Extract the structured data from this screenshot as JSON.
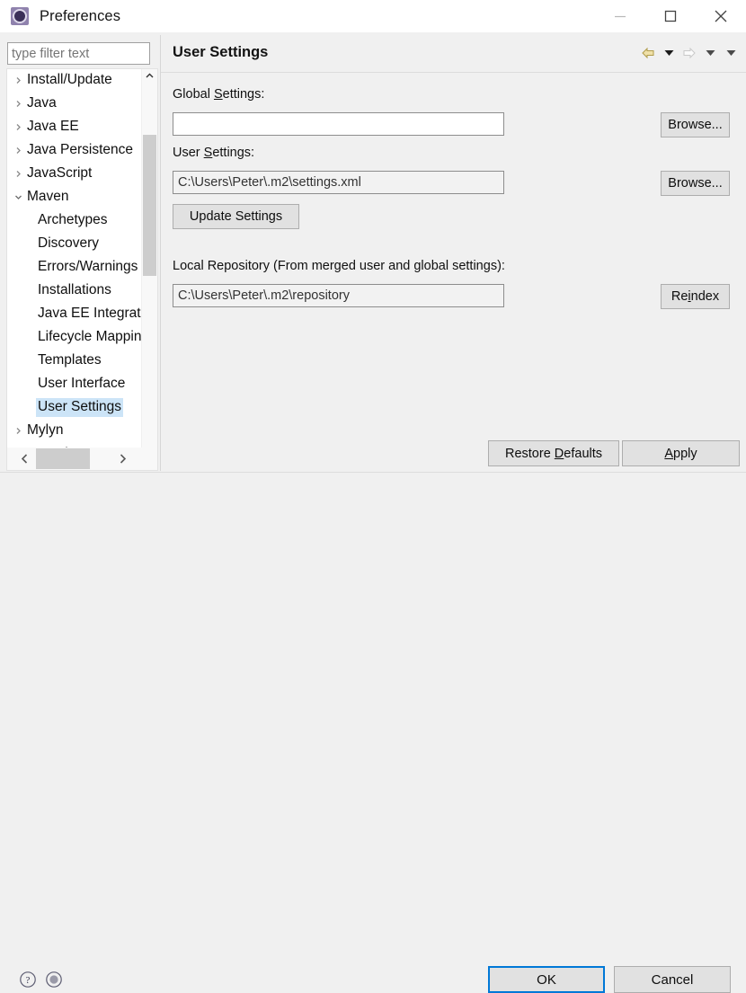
{
  "window": {
    "title": "Preferences",
    "icon": "preferences-gear-icon",
    "controls": {
      "minimize": "minimize-icon",
      "maximize": "maximize-icon",
      "close": "close-icon"
    }
  },
  "filter": {
    "value": "",
    "placeholder": "type filter text"
  },
  "tree": {
    "items": [
      {
        "label": "Install/Update",
        "twisty": "collapsed",
        "level": 0,
        "selected": false
      },
      {
        "label": "Java",
        "twisty": "collapsed",
        "level": 0,
        "selected": false
      },
      {
        "label": "Java EE",
        "twisty": "collapsed",
        "level": 0,
        "selected": false
      },
      {
        "label": "Java Persistence",
        "twisty": "collapsed",
        "level": 0,
        "selected": false
      },
      {
        "label": "JavaScript",
        "twisty": "collapsed",
        "level": 0,
        "selected": false
      },
      {
        "label": "Maven",
        "twisty": "expanded",
        "level": 0,
        "selected": false
      },
      {
        "label": "Archetypes",
        "twisty": "none",
        "level": 1,
        "selected": false
      },
      {
        "label": "Discovery",
        "twisty": "none",
        "level": 1,
        "selected": false
      },
      {
        "label": "Errors/Warnings",
        "twisty": "none",
        "level": 1,
        "selected": false
      },
      {
        "label": "Installations",
        "twisty": "none",
        "level": 1,
        "selected": false
      },
      {
        "label": "Java EE Integration",
        "twisty": "none",
        "level": 1,
        "selected": false
      },
      {
        "label": "Lifecycle Mappings",
        "twisty": "none",
        "level": 1,
        "selected": false
      },
      {
        "label": "Templates",
        "twisty": "none",
        "level": 1,
        "selected": false
      },
      {
        "label": "User Interface",
        "twisty": "none",
        "level": 1,
        "selected": false
      },
      {
        "label": "User Settings",
        "twisty": "none",
        "level": 1,
        "selected": true
      },
      {
        "label": "Mylyn",
        "twisty": "collapsed",
        "level": 0,
        "selected": false
      },
      {
        "label": "Oomph",
        "twisty": "collapsed",
        "level": 0,
        "selected": false
      }
    ],
    "scrollbars": {
      "vertical_up": "chevron-up-icon",
      "vertical_down": "chevron-down-icon",
      "horizontal_left": "chevron-left-icon",
      "horizontal_right": "chevron-right-icon"
    }
  },
  "page": {
    "title": "User Settings",
    "nav": {
      "back": "back-arrow-icon",
      "back_menu": "dropdown-arrow-icon",
      "forward": "forward-arrow-icon",
      "forward_menu": "dropdown-arrow-icon",
      "view_menu": "dropdown-arrow-icon"
    },
    "global_settings": {
      "label_pre": "Global ",
      "label_accel": "S",
      "label_post": "ettings:",
      "value": "",
      "browse_label": "Browse..."
    },
    "user_settings": {
      "label_pre": "User ",
      "label_accel": "S",
      "label_post": "ettings:",
      "value": "C:\\Users\\Peter\\.m2\\settings.xml",
      "browse_label": "Browse...",
      "update_label": "Update Settings"
    },
    "local_repository": {
      "label": "Local Repository (From merged user and global settings):",
      "value": "C:\\Users\\Peter\\.m2\\repository",
      "reindex_pre": "Re",
      "reindex_accel": "i",
      "reindex_post": "ndex"
    },
    "restore_defaults": {
      "pre": "Restore ",
      "accel": "D",
      "post": "efaults"
    },
    "apply": {
      "pre": "",
      "accel": "A",
      "post": "pply"
    }
  },
  "footer": {
    "help_icon": "help-question-icon",
    "record_icon": "record-circle-icon",
    "ok_label": "OK",
    "cancel_label": "Cancel"
  },
  "colors": {
    "selection": "#cce4f7",
    "focus_border": "#0078d7",
    "dialog_bg": "#f0f0f0",
    "button_bg": "#e1e1e1"
  }
}
